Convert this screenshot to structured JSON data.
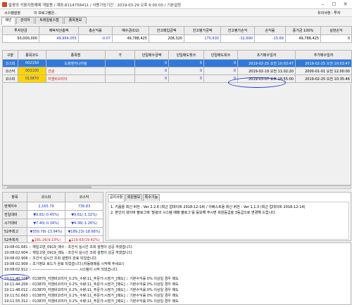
{
  "window": {
    "title": "말광의 키움자동매매 개발용 / 계좌:8114756411 / 사용가능기간 : 2019-03-29 오후 6:00:00 / 기본설정",
    "controls": [
      "–",
      "☐",
      "✕"
    ]
  },
  "menubar": {
    "items": [
      "시스템설정",
      "이 프로그램은..",
      "유의사항 : 투자"
    ]
  },
  "main_tabs": [
    "메인",
    "관리자",
    "트레일링스탑",
    "종목정보"
  ],
  "summary": {
    "headers": [
      "투자원금",
      "예탁자산총액",
      "총손익률",
      "예수금(D2)",
      "잔고매입금액",
      "잔고평가금액",
      "잔고평가손익",
      "손익률",
      "증거금 100%",
      "실현손익"
    ],
    "values": [
      "50,000,000",
      "49,964,055",
      "-0.07",
      "49,788,425",
      "208,320",
      "175,630",
      "-32,690",
      "-15.69",
      "49,788,425",
      "0"
    ]
  },
  "positions": {
    "headers": [
      "구분",
      "종목코드",
      "종목명",
      "가",
      "단일매수금액",
      "단일매도횟수",
      "단일매도회수",
      "초기매수일자",
      "추가매수일자"
    ],
    "rows": [
      {
        "market": "코스피",
        "code": "002150",
        "name": "도화엔지니어링",
        "price": "",
        "buy": "0",
        "sellcnt": "0",
        "sellcnt2": "0",
        "first": "2019-02-25 오전 10:03:47",
        "add": "2019-02-25 오전 10:03:47",
        "selected": true
      },
      {
        "market": "코스닥",
        "code": "003100",
        "name": "선광",
        "price": "",
        "buy": "0",
        "sellcnt": "0",
        "sellcnt2": "0",
        "first": "2019-02-19 오전 11:02:20",
        "add": "2000-01-01 오전 12:00:00",
        "selected": false
      },
      {
        "market": "코스피",
        "code": "013870",
        "name": "지엠비코리아",
        "price": "",
        "buy": "0",
        "sellcnt": "0",
        "sellcnt2": "0",
        "first": "2019-03-07 오후 18:55:00",
        "add": "2019-02-25 오전 10:35:46",
        "selected": false
      }
    ]
  },
  "market": {
    "headers": [
      "항목",
      "코스피",
      "코스닥"
    ],
    "rows": [
      {
        "label": "현재지수",
        "kospi": "2,165.79",
        "kosdaq": "736.83",
        "tone": "blue"
      },
      {
        "label": "전일대비",
        "kospi": "▼9.81(-0.45%)",
        "kosdaq": "▼9.61(-1.32%)",
        "tone": "blue"
      },
      {
        "label": "시가대비",
        "kospi": "▼7.40(-0.34%)",
        "kosdaq": "▼9.36(-1.26%)",
        "tone": "blue"
      },
      {
        "label": "52주최고",
        "kospi": "▼350.78(-13.94%)",
        "kosdaq": "▼189.23(-18.68%)",
        "tone": "blue"
      },
      {
        "label": "52주최저",
        "kospi": "▲181.26(9.13%)",
        "kosdaq": "▲119.63(19.42%)",
        "tone": "red"
      }
    ]
  },
  "notice": {
    "tabs": [
      "공지사항",
      "회원정보",
      "특수기능"
    ],
    "lines": [
      "1. 키움용 최신 버전 : Ver 2.2.6 (최근 업데이트 2018-12-14) / 이베스트용 최신 버전 : Ver 1.1.3 (최근 업데이트 2018-12-14)",
      "2. 본인의 네이버 블로그에 '말광의 시스템 매매 블로그'를 등보해 주시면 회원등급을 3등급으로 변경해 드립니다."
    ]
  },
  "log": [
    "19:08:01.681 :: 재일고양_0919_매수 - 조건식 실시간 조회 설명이 성공 하였습니다.",
    "19:08:02.904 :: 재일고양_0919_매도 - 조건식 실시간 조회 설명이 성공 하였습니다.",
    "19:08:02.906 :: 조건식 실시간 조회 설명이 완료 되었습니다.",
    "19:08:02.909 :: 초기정보 로드가 완료 되었습니다.(자동매매를 시작해 주세요!)",
    "19:08:02.912 :: ------------------------------------ 시스템이 시작 되었습니다.",
    "19:11:40.108 :: 013870_지엠비코리아_0.2%_수량:11_주문가:시장가_[매도] :: 기본수익률 0% 이상일 경우 매도",
    "19:11:44.209 :: 013870_지엠비코리아_0.2%_수량:11_주문가:시장가_[매도] :: 기본수익률 0% 이상일 경우 매도",
    "19:11:48.012 :: 013870_지엠비코리아_0.2%_수량:11_주문가:시장가_[매도] :: 기본수익률 0% 이상일 경우 매도",
    "19:11:51.663 :: 013870_지엠비코리아_0.2%_수량:11_주문가:시장가_[매도] :: 기본수익률 0% 이상일 경우 매도",
    "19:11:55.312 :: 013870_지엠비코리아_0.2%_수량:11_주문가:시장가_[매도] :: 기본수익률 0% 이상일 경우 매도"
  ]
}
